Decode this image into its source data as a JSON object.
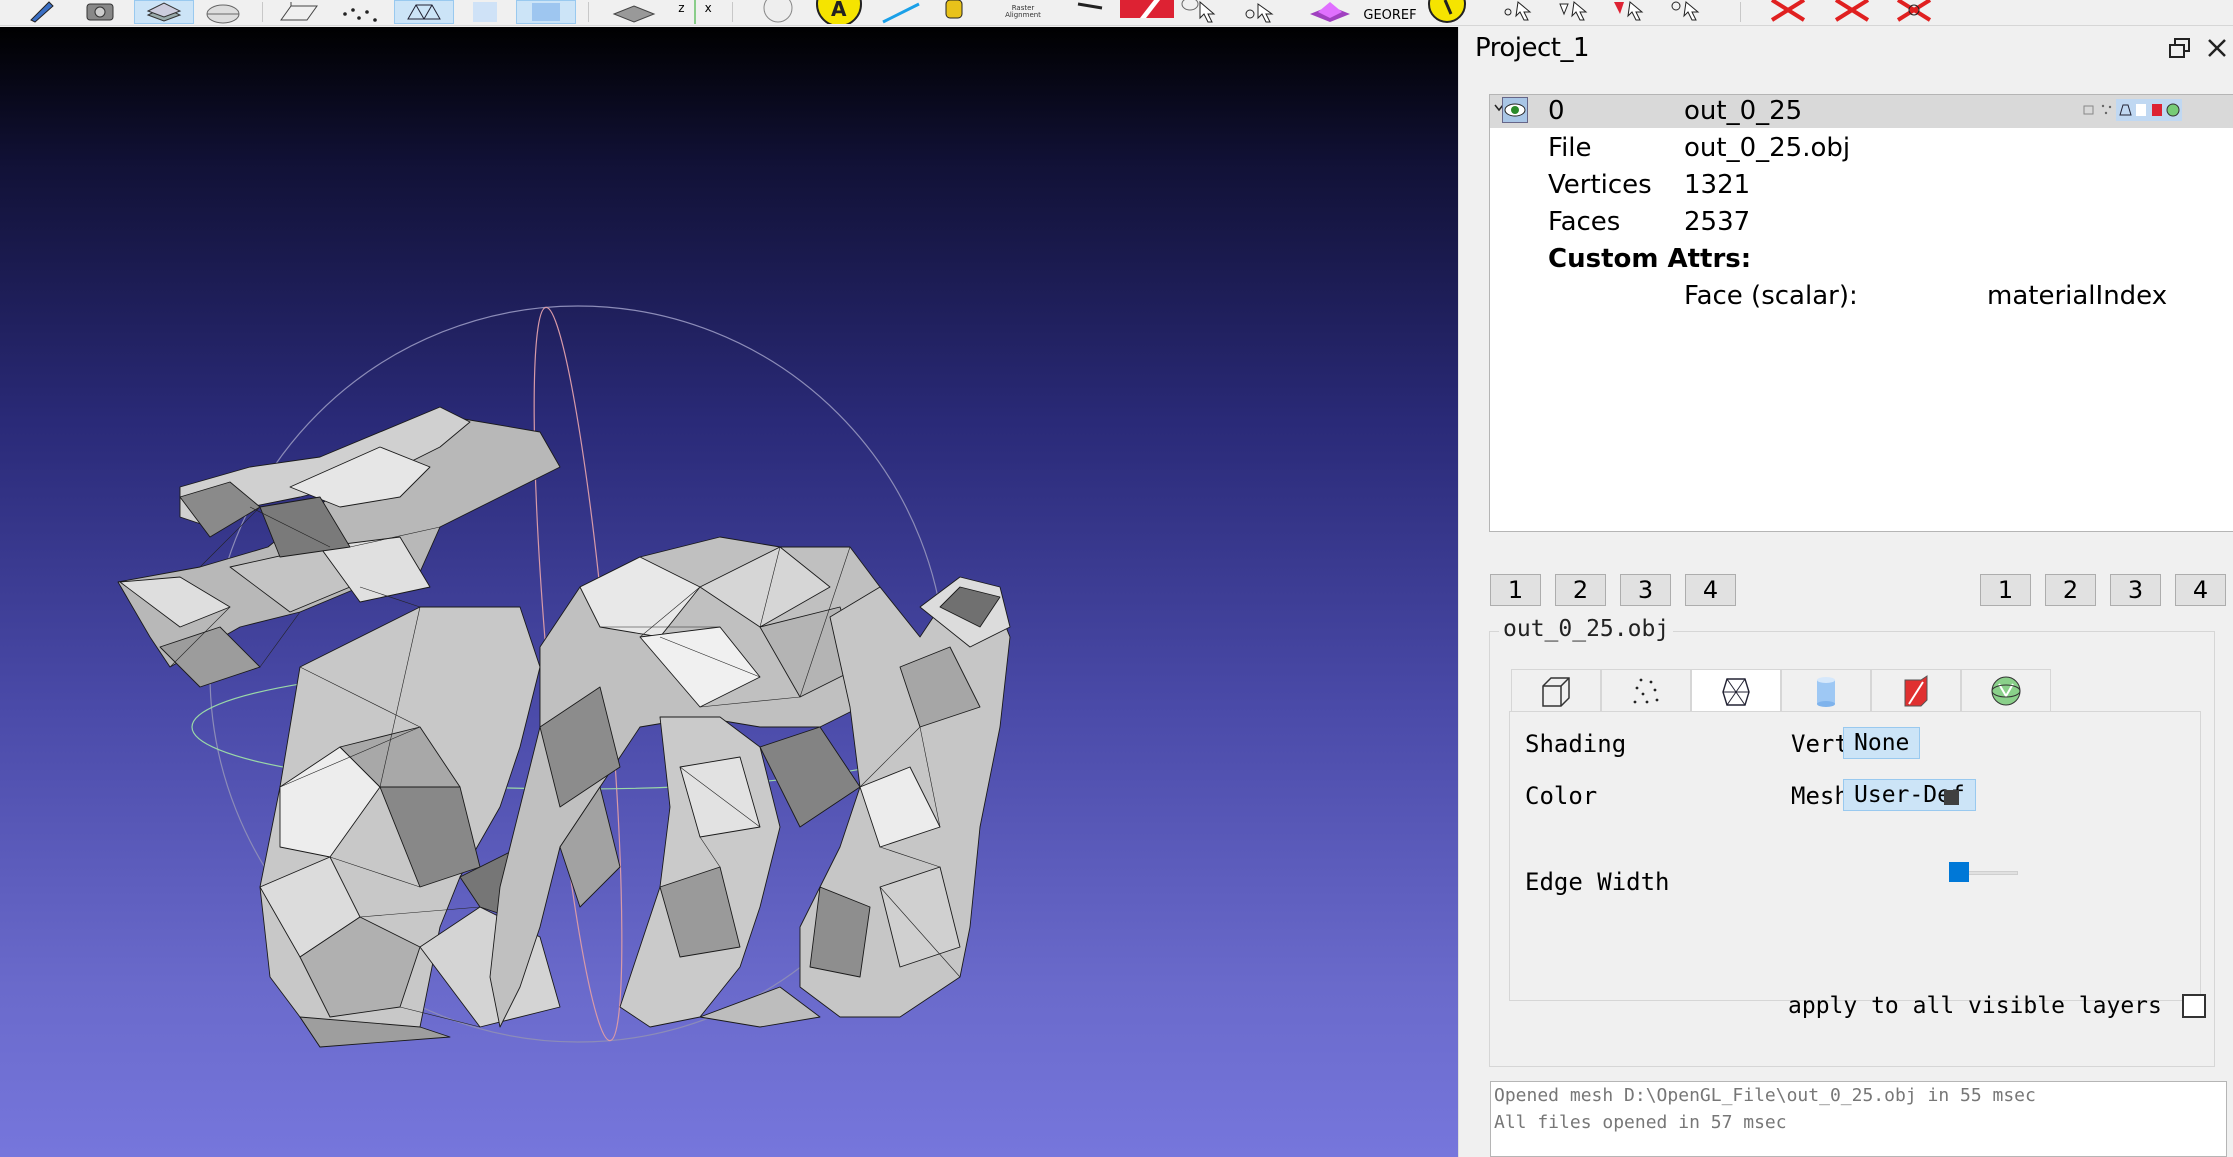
{
  "toolbar": {
    "raster_alignment_label": "Raster Alignment",
    "georef_label": "GEOREF",
    "axis_labels": [
      "z",
      "x"
    ]
  },
  "project": {
    "title": "Project_1"
  },
  "layers": {
    "row": {
      "index": "0",
      "name": "out_0_25"
    },
    "info": [
      {
        "key": "File",
        "value": "out_0_25.obj"
      },
      {
        "key": "Vertices",
        "value": "1321"
      },
      {
        "key": "Faces",
        "value": "2537"
      }
    ],
    "custom_attrs_label": "Custom Attrs:",
    "attr": {
      "scope": "Face (scalar):",
      "name": "materialIndex"
    }
  },
  "view_buttons_left": [
    "1",
    "2",
    "3",
    "4"
  ],
  "view_buttons_right": [
    "1",
    "2",
    "3",
    "4"
  ],
  "decorator": {
    "group_title": "out_0_25.obj",
    "tabs": [
      {
        "icon": "box-wireframe-icon"
      },
      {
        "icon": "points-icon"
      },
      {
        "icon": "wireframe-mesh-icon",
        "active": true
      },
      {
        "icon": "cylinder-icon"
      },
      {
        "icon": "texture-icon"
      },
      {
        "icon": "sphere-grid-icon"
      }
    ],
    "shading_label": "Shading",
    "shading_sub": "Vert",
    "shading_value": "None",
    "color_label": "Color",
    "color_sub": "Mesh",
    "color_value": "User-Def",
    "edge_width_label": "Edge Width",
    "edge_width_value": 0
  },
  "apply_all_label": "apply to all visible layers",
  "apply_all_checked": false,
  "log": [
    "Opened mesh D:\\OpenGL_File\\out_0_25.obj in 55 msec",
    "All files opened in 57 msec"
  ],
  "colors": {
    "viewport_top": "#000000",
    "viewport_bottom": "#7676dc",
    "selection_blue": "#cce4f7",
    "slider_blue": "#0078d7"
  }
}
